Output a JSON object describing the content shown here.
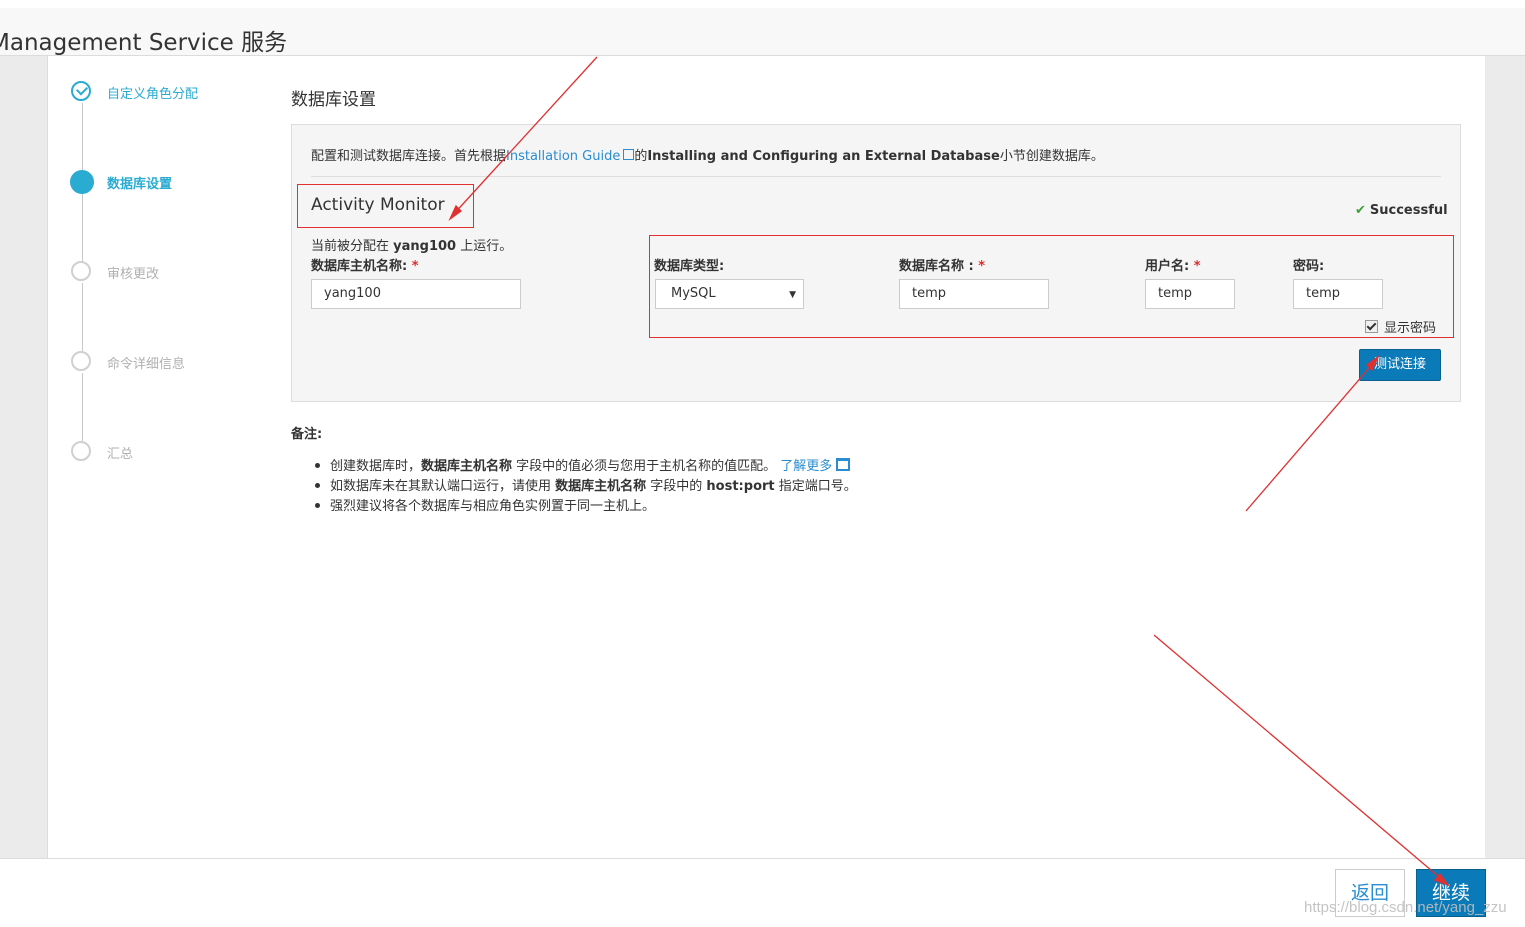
{
  "header": {
    "title": "Management Service 服务"
  },
  "wizard": {
    "steps": [
      {
        "label": "自定义角色分配",
        "state": "done"
      },
      {
        "label": "数据库设置",
        "state": "active"
      },
      {
        "label": "审核更改",
        "state": "pending"
      },
      {
        "label": "命令详细信息",
        "state": "pending"
      },
      {
        "label": "汇总",
        "state": "pending"
      }
    ]
  },
  "main": {
    "section_title": "数据库设置",
    "intro": {
      "prefix": "配置和测试数据库连接。首先根据",
      "link": "Installation Guide",
      "middle": "的",
      "bold": "Installing and Configuring an External Database",
      "suffix": "小节创建数据库。"
    },
    "role": {
      "title": "Activity Monitor",
      "status": "Successful",
      "assigned_prefix": "当前被分配在 ",
      "assigned_host": "yang100",
      "assigned_suffix": " 上运行。",
      "host_label": "数据库主机名称:",
      "host_value": "yang100",
      "db_type_label": "数据库类型:",
      "db_type_value": "MySQL",
      "db_name_label": "数据库名称 :",
      "db_name_value": "temp",
      "user_label": "用户名:",
      "user_value": "temp",
      "password_label": "密码:",
      "password_value": "temp",
      "show_password_label": "显示密码",
      "required_mark": "*",
      "test_button": "测试连接"
    },
    "notes": {
      "title": "备注:",
      "items": [
        {
          "a": "创建数据库时，",
          "b": "数据库主机名称",
          "c": " 字段中的值必须与您用于主机名称的值匹配。 ",
          "link": "了解更多"
        },
        {
          "a": "如数据库未在其默认端口运行，请使用 ",
          "b": "数据库主机名称",
          "c": " 字段中的 ",
          "d": "host:port",
          "e": " 指定端口号。"
        },
        {
          "a": "强烈建议将各个数据库与相应角色实例置于同一主机上。"
        }
      ]
    }
  },
  "footer": {
    "back_button": "返回",
    "continue_button": "继续",
    "watermark": "https://blog.csdn.net/yang_zzu"
  },
  "colors": {
    "accent": "#2aabd2",
    "primary_button": "#0b7ab8",
    "annotation": "#e03030",
    "success": "#3aa03a"
  }
}
